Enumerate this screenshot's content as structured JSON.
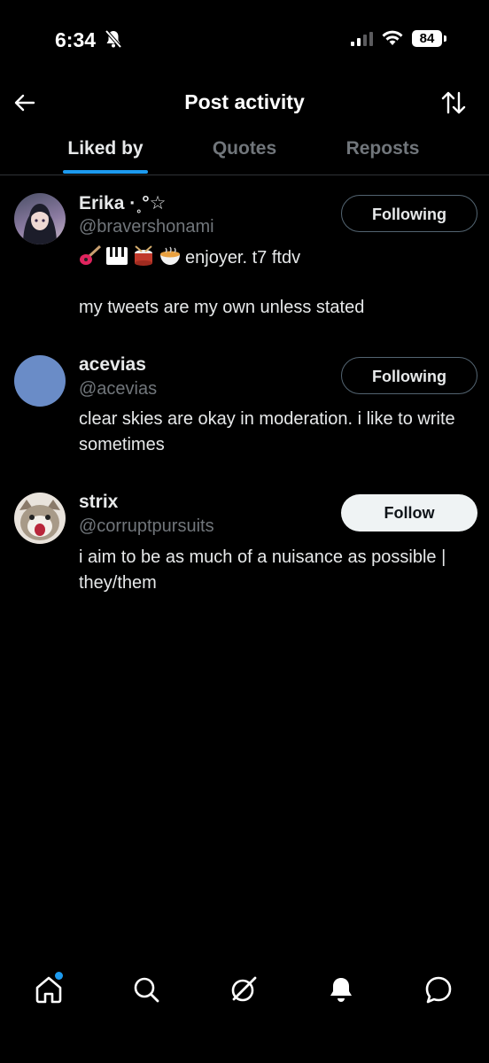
{
  "status": {
    "time": "6:34",
    "battery": "84"
  },
  "header": {
    "title": "Post activity"
  },
  "tabs": [
    {
      "label": "Liked by",
      "active": true
    },
    {
      "label": "Quotes",
      "active": false
    },
    {
      "label": "Reposts",
      "active": false
    }
  ],
  "users": [
    {
      "name": "Erika ·˳°☆",
      "handle": "@bravershonami",
      "bio_line1": "enjoyer. t7 ftdv",
      "bio_emojis": [
        "guitar-emoji",
        "piano-emoji",
        "drum-emoji",
        "bowl-emoji"
      ],
      "bio_line2": "my tweets are my own unless stated",
      "button": "Following"
    },
    {
      "name": "acevias",
      "handle": "@acevias",
      "bio": "clear skies are okay in moderation. i like to write sometimes",
      "button": "Following",
      "avatar_color": "#6a8cc7"
    },
    {
      "name": "strix",
      "handle": "@corruptpursuits",
      "bio": "i aim to be as much of a nuisance as possible | they/them",
      "button": "Follow"
    }
  ],
  "nav": [
    "home-icon",
    "search-icon",
    "grok-icon",
    "notifications-icon",
    "messages-icon"
  ],
  "colors": {
    "accent": "#1d9bf0",
    "background": "#000000",
    "muted": "#71767b"
  }
}
